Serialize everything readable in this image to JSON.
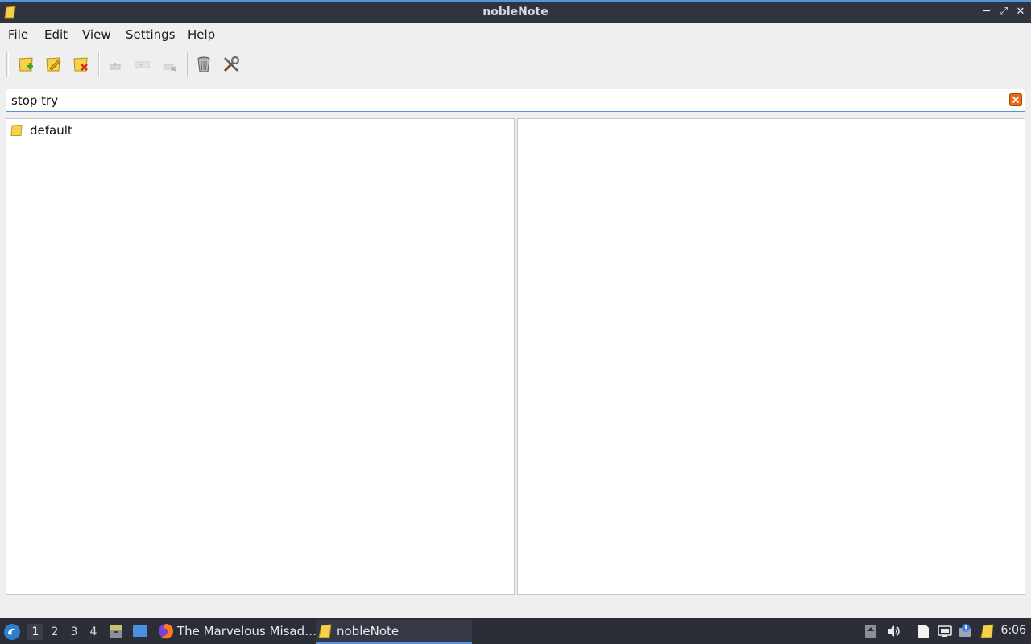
{
  "window": {
    "title": "nobleNote"
  },
  "menu": {
    "file": "File",
    "edit": "Edit",
    "view": "View",
    "settings": "Settings",
    "help": "Help"
  },
  "search": {
    "value": "stop try"
  },
  "folders": [
    {
      "label": "default"
    }
  ],
  "taskbar": {
    "workspaces": [
      "1",
      "2",
      "3",
      "4"
    ],
    "tasks": [
      {
        "label": "The Marvelous Misad…"
      },
      {
        "label": "nobleNote"
      }
    ],
    "clock": "6:06"
  }
}
